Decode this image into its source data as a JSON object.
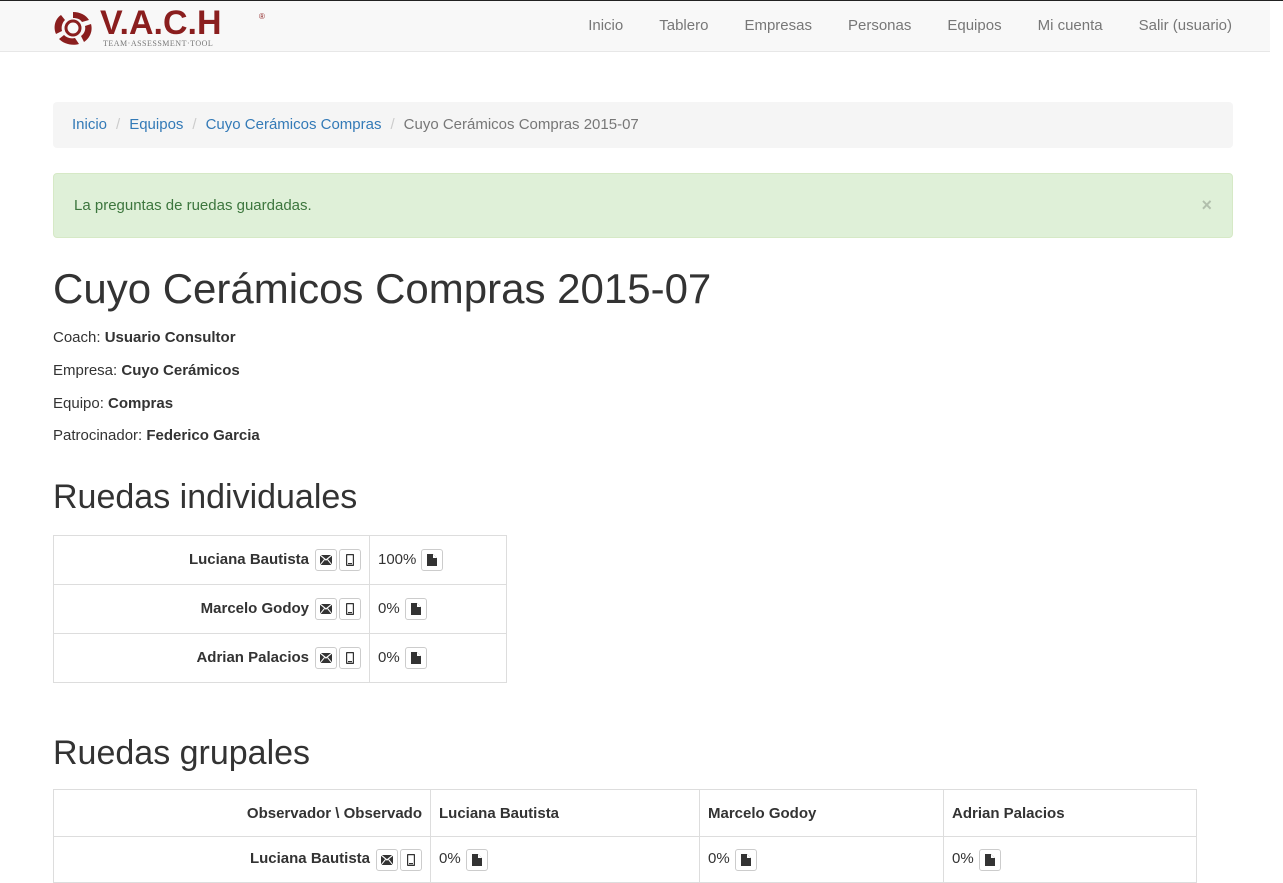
{
  "brand": {
    "name": "V.A.C.H",
    "mark": "®",
    "subtitle": "TEAM·ASSESSMENT·TOOL"
  },
  "nav": {
    "items": [
      "Inicio",
      "Tablero",
      "Empresas",
      "Personas",
      "Equipos",
      "Mi cuenta",
      "Salir (usuario)"
    ]
  },
  "breadcrumb": {
    "items": [
      "Inicio",
      "Equipos",
      "Cuyo Cerámicos Compras"
    ],
    "active": "Cuyo Cerámicos Compras 2015-07",
    "separator": "/"
  },
  "alert": {
    "message": "La preguntas de ruedas guardadas.",
    "close": "×"
  },
  "page": {
    "title": "Cuyo Cerámicos Compras 2015-07",
    "coach_label": "Coach:",
    "coach": "Usuario Consultor",
    "empresa_label": "Empresa:",
    "empresa": "Cuyo Cerámicos",
    "equipo_label": "Equipo:",
    "equipo": "Compras",
    "patrocinador_label": "Patrocinador:",
    "patrocinador": "Federico Garcia"
  },
  "individual": {
    "title": "Ruedas individuales",
    "rows": [
      {
        "name": "Luciana Bautista",
        "progress": "100%"
      },
      {
        "name": "Marcelo Godoy",
        "progress": "0%"
      },
      {
        "name": "Adrian Palacios",
        "progress": "0%"
      }
    ]
  },
  "group": {
    "title": "Ruedas grupales",
    "headers": [
      "Observador \\ Observado",
      "Luciana Bautista",
      "Marcelo Godoy",
      "Adrian Palacios"
    ],
    "rows": [
      {
        "name": "Luciana Bautista",
        "values": [
          "0%",
          "0%",
          "0%"
        ]
      }
    ]
  },
  "icons": {
    "email": "envelope-icon",
    "mobile": "mobile-phone-icon",
    "report": "document-icon"
  },
  "colors": {
    "brand": "#8a1e1e",
    "link": "#337ab7",
    "alert_bg": "#dff0d8",
    "alert_text": "#3c763d"
  }
}
